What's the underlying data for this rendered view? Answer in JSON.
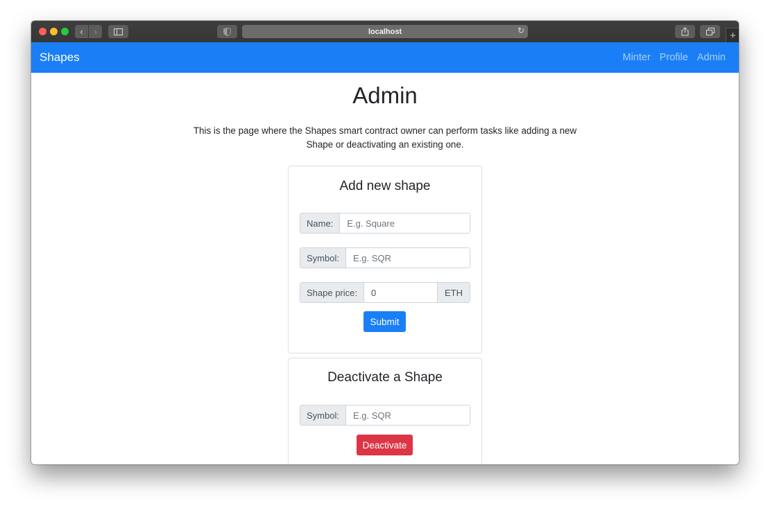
{
  "browser": {
    "url": "localhost"
  },
  "navbar": {
    "brand": "Shapes",
    "links": [
      "Minter",
      "Profile",
      "Admin"
    ]
  },
  "page": {
    "title": "Admin",
    "description": "This is the page where the Shapes smart contract owner can perform tasks like adding a new Shape or deactivating an existing one."
  },
  "add_shape": {
    "title": "Add new shape",
    "name_label": "Name:",
    "name_placeholder": "E.g. Square",
    "symbol_label": "Symbol:",
    "symbol_placeholder": "E.g. SQR",
    "price_label": "Shape price:",
    "price_value": "0",
    "price_unit": "ETH",
    "submit_label": "Submit"
  },
  "deactivate_shape": {
    "title": "Deactivate a Shape",
    "symbol_label": "Symbol:",
    "symbol_placeholder": "E.g. SQR",
    "deactivate_label": "Deactivate"
  },
  "colors": {
    "primary": "#1a7ff6",
    "danger": "#dc3545",
    "nav_link": "#a9cffb"
  }
}
